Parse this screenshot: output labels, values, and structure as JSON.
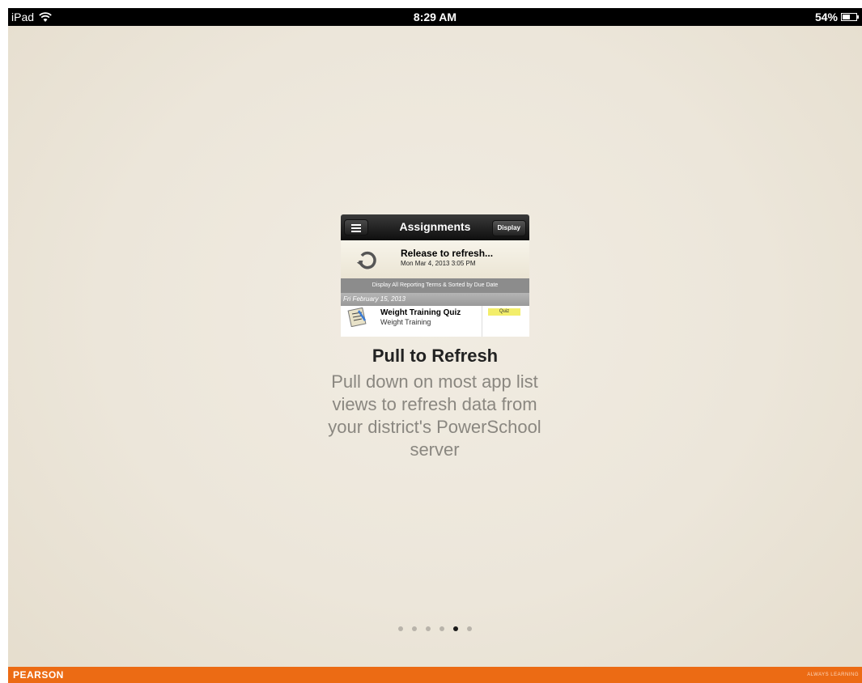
{
  "status_bar": {
    "device": "iPad",
    "time": "8:29 AM",
    "battery": "54%",
    "battery_level": 0.54,
    "icons": [
      "wifi-icon",
      "battery-icon"
    ]
  },
  "preview": {
    "nav_title": "Assignments",
    "display_button": "Display",
    "refresh_title": "Release to refresh...",
    "refresh_date": "Mon Mar 4, 2013 3:05 PM",
    "filter_text": "Display All Reporting Terms & Sorted by Due Date",
    "section_header": "Fri February 15, 2013",
    "row_title": "Weight Training Quiz",
    "row_subtitle": "Weight Training",
    "row_badge": "Quiz"
  },
  "tutorial": {
    "title": "Pull to Refresh",
    "description": "Pull down on most app list views to refresh data from your district's PowerSchool server"
  },
  "pagination": {
    "total": 6,
    "active_index": 4
  },
  "footer": {
    "brand": "PEARSON",
    "tagline": "ALWAYS LEARNING",
    "color": "#ec6b14"
  }
}
